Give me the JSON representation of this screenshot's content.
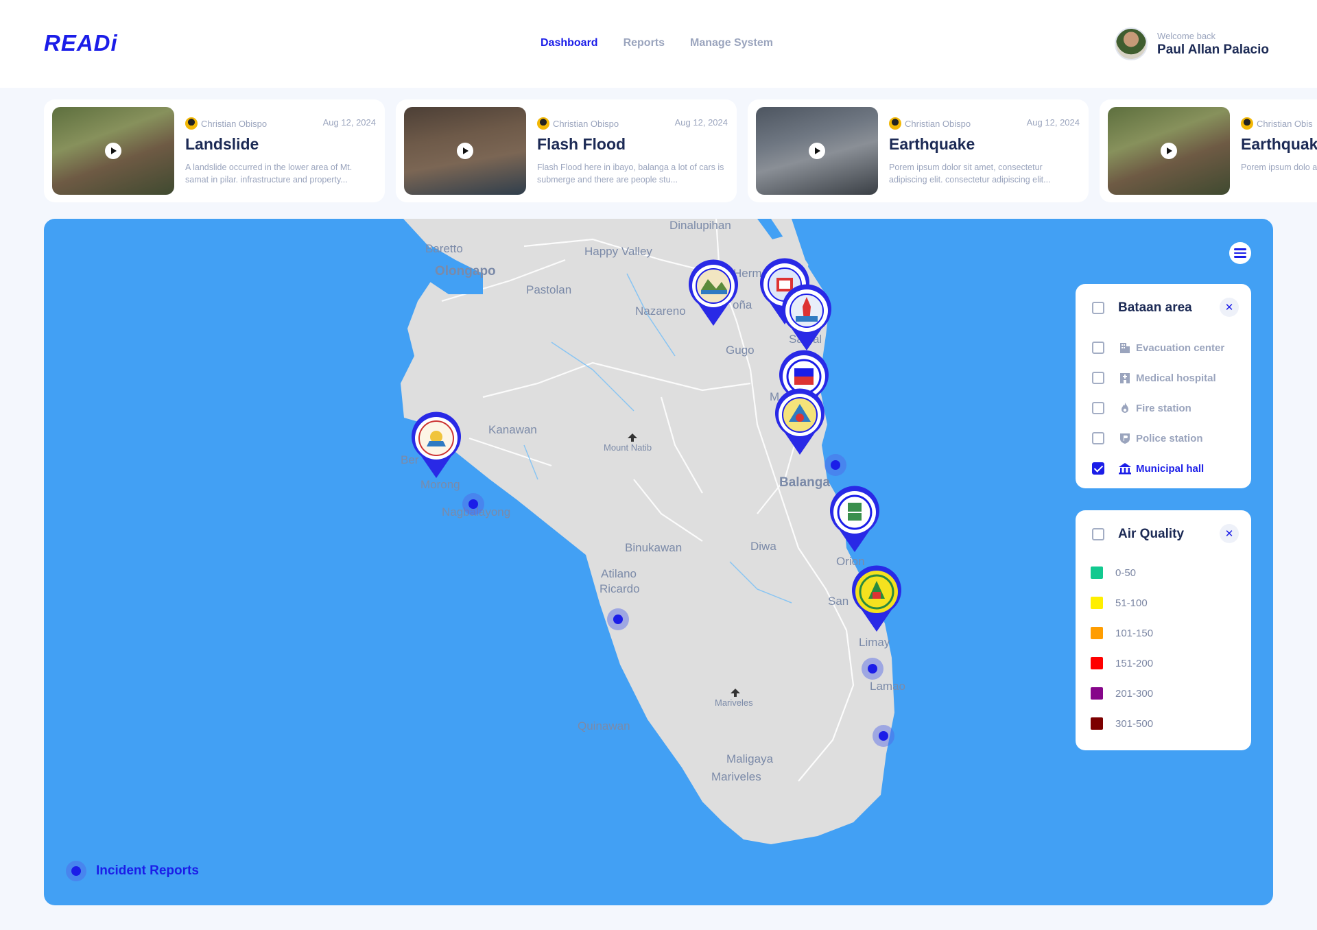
{
  "app": {
    "logo": "READi"
  },
  "nav": {
    "items": [
      {
        "label": "Dashboard",
        "active": true
      },
      {
        "label": "Reports",
        "active": false
      },
      {
        "label": "Manage System",
        "active": false
      }
    ]
  },
  "user": {
    "welcome": "Welcome back",
    "name": "Paul Allan Palacio"
  },
  "incidents": [
    {
      "author": "Christian Obispo",
      "date": "Aug 12, 2024",
      "title": "Landslide",
      "description": "A landslide occurred in the lower area of Mt. samat in pilar. infrastructure and property...",
      "thumb": "landslide-video"
    },
    {
      "author": "Christian Obispo",
      "date": "Aug 12, 2024",
      "title": "Flash Flood",
      "description": "Flash Flood here in ibayo, balanga a lot of cars is submerge and there are people stu...",
      "thumb": "flood-video"
    },
    {
      "author": "Christian Obispo",
      "date": "Aug 12, 2024",
      "title": "Earthquake",
      "description": "Porem ipsum dolor sit amet, consectetur adipiscing elit. consectetur adipiscing elit...",
      "thumb": "earthquake-video"
    },
    {
      "author": "Christian Obis",
      "date": "",
      "title": "Earthquak",
      "description": "Porem ipsum dolo adipiscing elit. co",
      "thumb": "landslide-video"
    }
  ],
  "map": {
    "places": {
      "dinalupihan": "Dinalupihan",
      "baretto": "Baretto",
      "happy_valley": "Happy Valley",
      "olongapo": "Olongapo",
      "pastolan": "Pastolan",
      "nazareno": "Nazareno",
      "hermosa": "Herm",
      "orani_frag": "oña",
      "samal": "Samal",
      "gugo": "Gugo",
      "kanawan": "Kanawan",
      "mount_natib": "Mount Natib",
      "bagac_frag": "Ber",
      "morong": "Morong",
      "nagbalayong": "Nagbalayong",
      "balanga": "Balanga",
      "binukawan": "Binukawan",
      "diwa": "Diwa",
      "orion": "Orion",
      "atilano": "Atilano",
      "ricardo": "Ricardo",
      "san_frag": "San",
      "limay": "Limay",
      "mariveles_mt": "Mariveles",
      "lamao": "Lamao",
      "quinawan": "Quinawan",
      "maligaya": "Maligaya",
      "mariveles": "Mariveles",
      "m_frag": "M"
    },
    "municipal_pins": [
      "hermosa-seal",
      "orani-seal",
      "samal-seal",
      "abucay-seal",
      "balanga-seal",
      "morong-seal",
      "orion-seal",
      "limay-seal"
    ],
    "incident_legend": "Incident Reports"
  },
  "area_panel": {
    "title": "Bataan area",
    "checked": false,
    "items": [
      {
        "label": "Evacuation center",
        "icon": "building-icon",
        "checked": false
      },
      {
        "label": "Medical hospital",
        "icon": "hospital-icon",
        "checked": false
      },
      {
        "label": "Fire station",
        "icon": "fire-icon",
        "checked": false
      },
      {
        "label": "Police station",
        "icon": "police-badge-icon",
        "checked": false
      },
      {
        "label": "Municipal hall",
        "icon": "municipal-hall-icon",
        "checked": true
      }
    ]
  },
  "air_panel": {
    "title": "Air Quality",
    "checked": false,
    "levels": [
      {
        "label": "0-50",
        "color": "#12c98f"
      },
      {
        "label": "51-100",
        "color": "#ffef00"
      },
      {
        "label": "101-150",
        "color": "#ff9d00"
      },
      {
        "label": "151-200",
        "color": "#ff0000"
      },
      {
        "label": "201-300",
        "color": "#86068a"
      },
      {
        "label": "301-500",
        "color": "#7c0000"
      }
    ]
  },
  "colors": {
    "accent": "#1b1de8",
    "map_water": "#42a0f4",
    "map_land": "#dedede"
  }
}
